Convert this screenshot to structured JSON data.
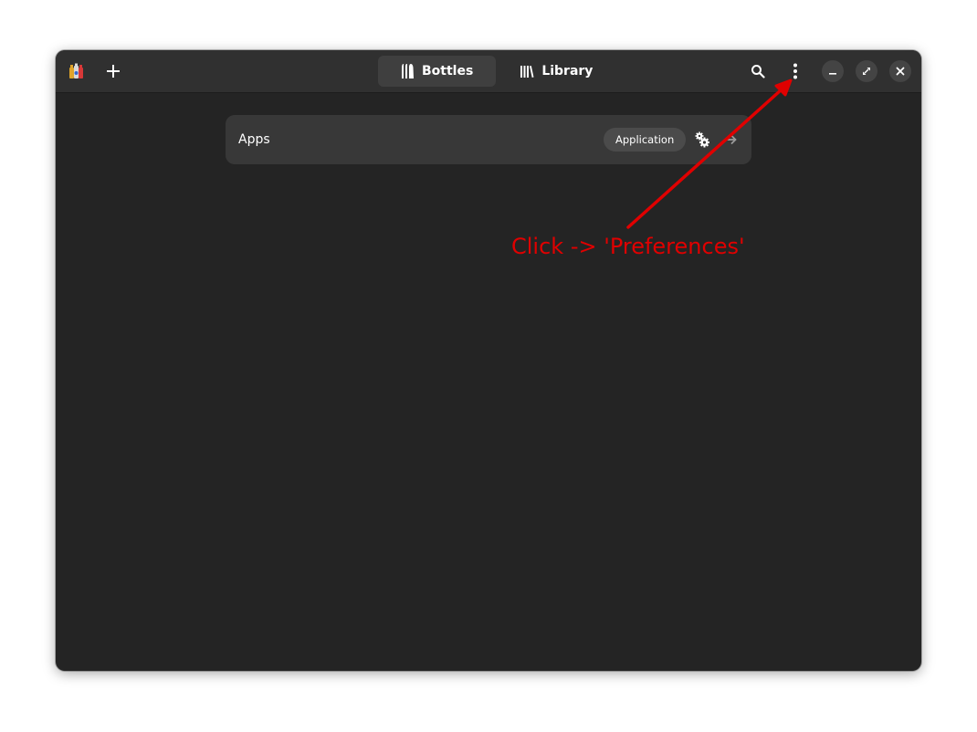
{
  "header": {
    "tabs": [
      {
        "label": "Bottles",
        "icon": "bottles-icon",
        "active": true
      },
      {
        "label": "Library",
        "icon": "library-icon",
        "active": false
      }
    ],
    "buttons": {
      "add": "add-icon",
      "search": "search-icon",
      "menu": "kebab-menu-icon",
      "minimize": "minimize-icon",
      "maximize": "maximize-icon",
      "close": "close-icon"
    }
  },
  "bottles": [
    {
      "name": "Apps",
      "environment": "Application"
    }
  ],
  "annotation": {
    "text": "Click -> 'Preferences'",
    "color": "#e00000"
  },
  "colors": {
    "window_bg": "#242424",
    "headerbar_bg": "#303030",
    "row_bg": "#383838",
    "badge_bg": "#4b4b4b"
  }
}
